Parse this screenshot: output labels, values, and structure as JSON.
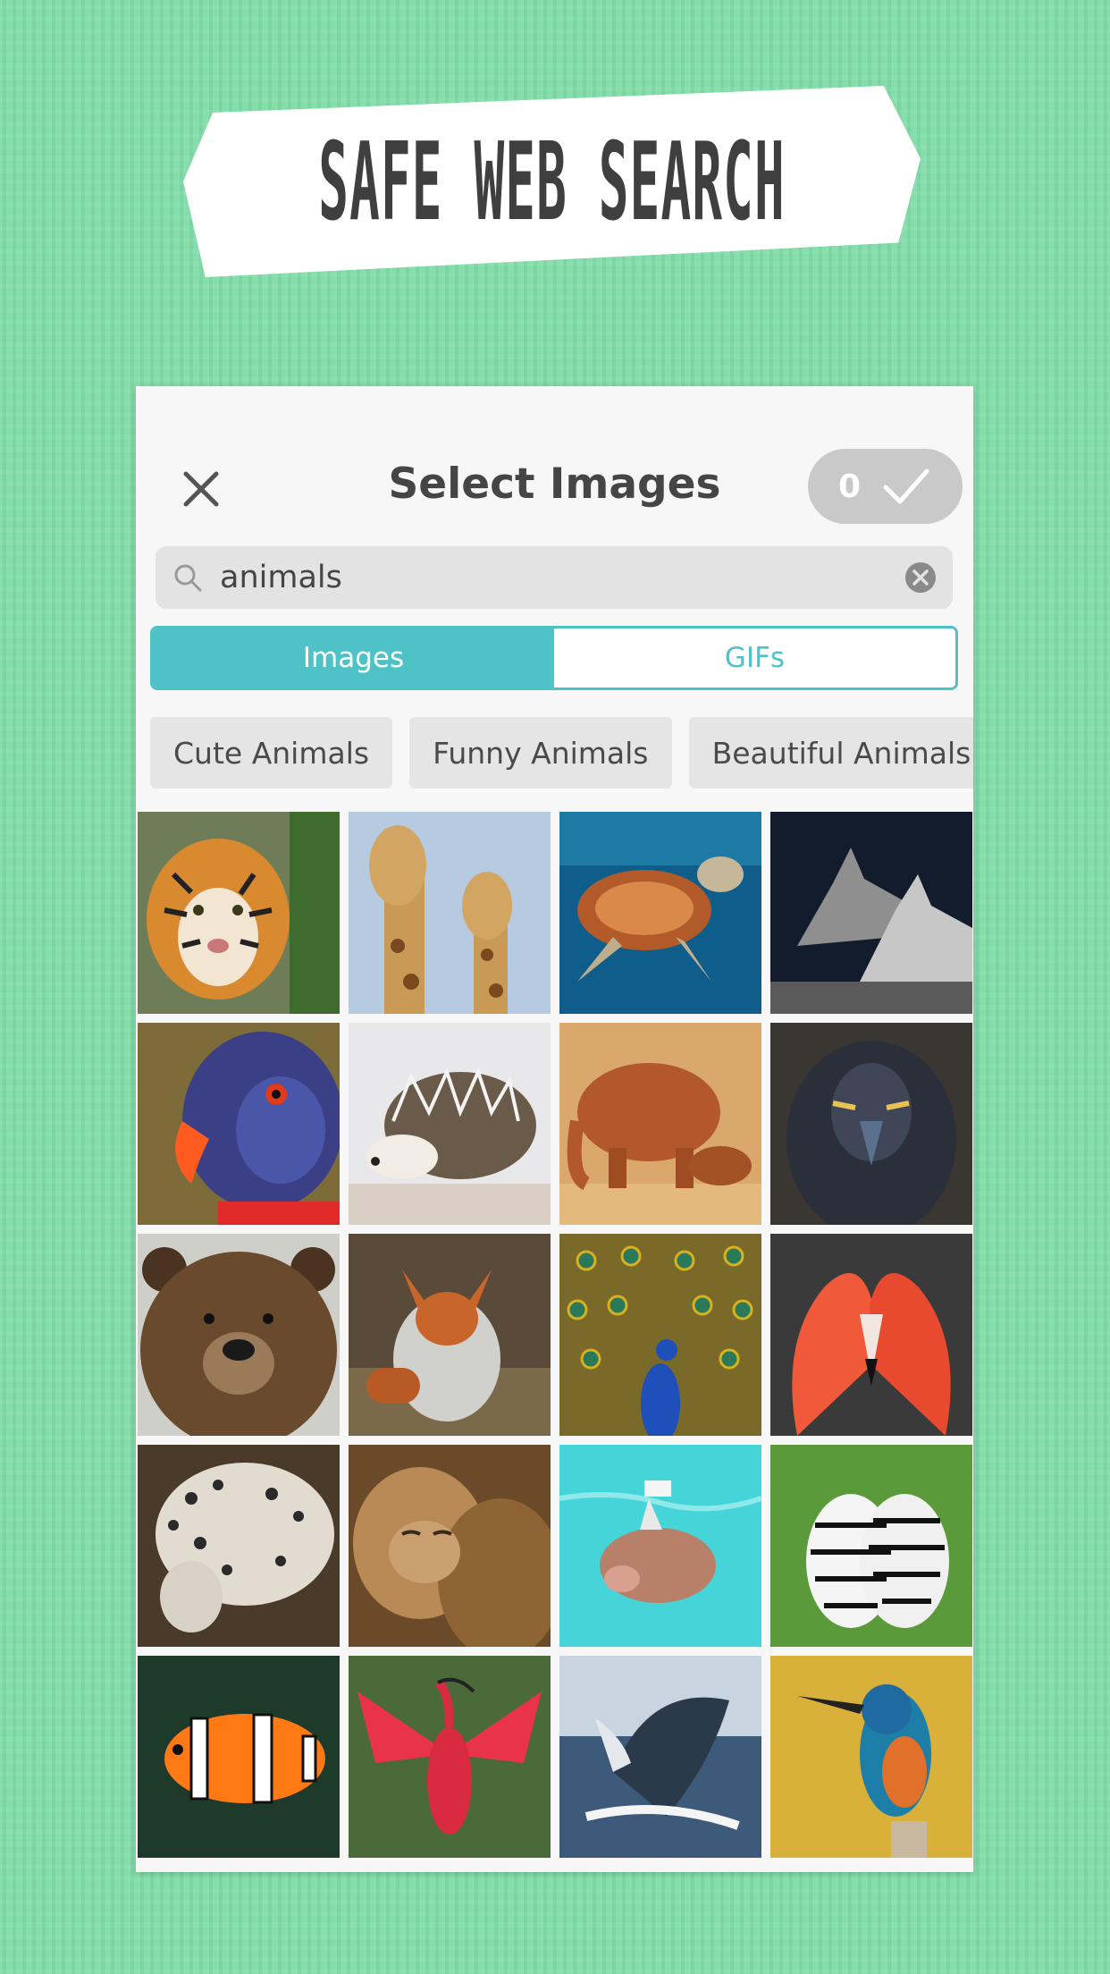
{
  "banner": {
    "title": "SAFE WEB SEARCH"
  },
  "header": {
    "title": "Select Images",
    "selected_count": "0"
  },
  "search": {
    "value": "animals"
  },
  "tabs": [
    {
      "label": "Images",
      "active": true
    },
    {
      "label": "GIFs",
      "active": false
    }
  ],
  "suggestions": [
    "Cute Animals",
    "Funny Animals",
    "Beautiful Animals"
  ],
  "images": [
    {
      "subject": "tiger"
    },
    {
      "subject": "giraffes"
    },
    {
      "subject": "sea turtle"
    },
    {
      "subject": "wolves"
    },
    {
      "subject": "parrot"
    },
    {
      "subject": "hedgehog"
    },
    {
      "subject": "elephants"
    },
    {
      "subject": "eagle"
    },
    {
      "subject": "bear"
    },
    {
      "subject": "fox"
    },
    {
      "subject": "peacock"
    },
    {
      "subject": "flamingos"
    },
    {
      "subject": "leopard"
    },
    {
      "subject": "lions"
    },
    {
      "subject": "swimming pig"
    },
    {
      "subject": "zebras"
    },
    {
      "subject": "clownfish"
    },
    {
      "subject": "scarlet ibis"
    },
    {
      "subject": "whale"
    },
    {
      "subject": "kingfisher"
    }
  ],
  "colors": {
    "accent": "#4fc2c8",
    "background": "#7fdca7",
    "done_button": "#c9c9c9"
  }
}
